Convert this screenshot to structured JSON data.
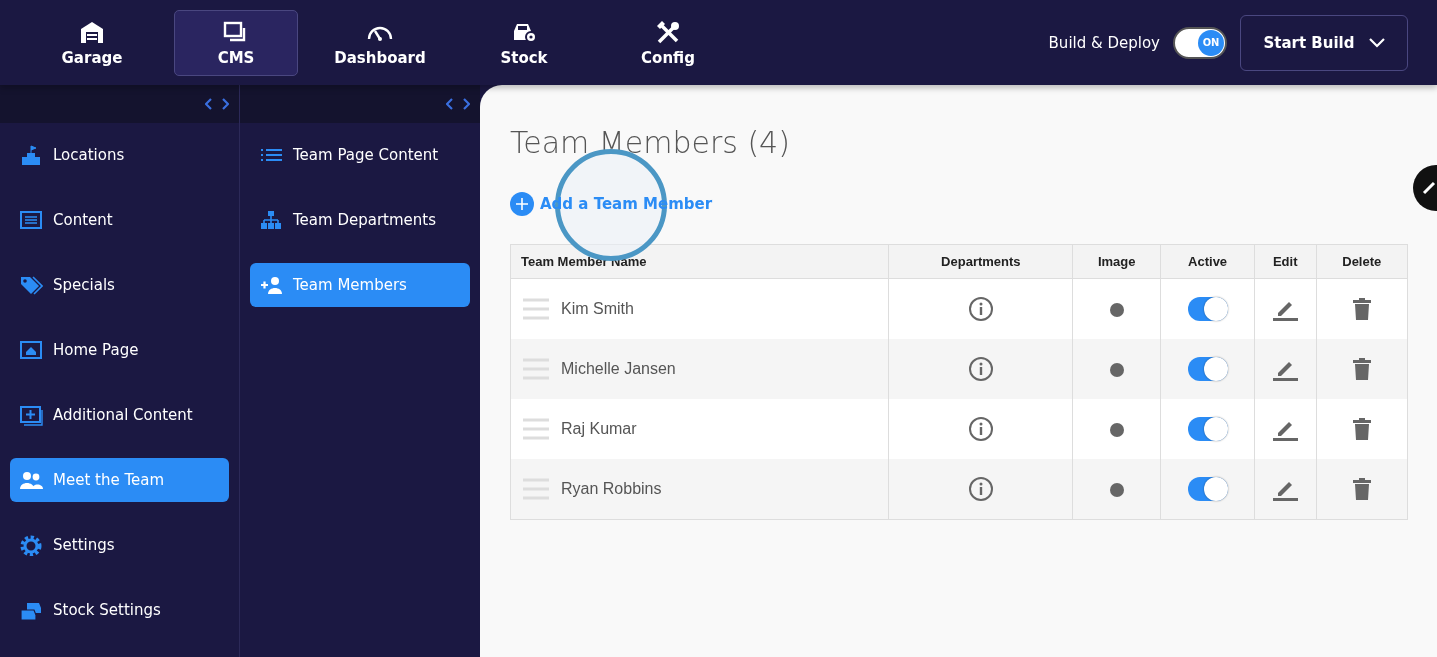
{
  "top_nav": [
    {
      "label": "Garage",
      "kind": "garage",
      "selected": false
    },
    {
      "label": "CMS",
      "kind": "cms",
      "selected": true
    },
    {
      "label": "Dashboard",
      "kind": "gauge",
      "selected": false
    },
    {
      "label": "Stock",
      "kind": "car",
      "selected": false
    },
    {
      "label": "Config",
      "kind": "tools",
      "selected": false
    }
  ],
  "build_deploy": {
    "label": "Build & Deploy",
    "toggle_text": "ON",
    "on": true
  },
  "start_build": {
    "label": "Start Build"
  },
  "sidebar": {
    "items": [
      {
        "label": "Locations",
        "kind": "location",
        "selected": false
      },
      {
        "label": "Content",
        "kind": "content",
        "selected": false
      },
      {
        "label": "Specials",
        "kind": "tag",
        "selected": false
      },
      {
        "label": "Home Page",
        "kind": "home",
        "selected": false
      },
      {
        "label": "Additional Content",
        "kind": "add",
        "selected": false
      },
      {
        "label": "Meet the Team",
        "kind": "team",
        "selected": true
      },
      {
        "label": "Settings",
        "kind": "gear",
        "selected": false
      },
      {
        "label": "Stock Settings",
        "kind": "cars",
        "selected": false
      }
    ]
  },
  "subnav": {
    "items": [
      {
        "label": "Team Page Content",
        "kind": "list",
        "selected": false
      },
      {
        "label": "Team Departments",
        "kind": "hierarchy",
        "selected": false
      },
      {
        "label": "Team Members",
        "kind": "adduser",
        "selected": true
      }
    ]
  },
  "main": {
    "title": "Team Members (4)",
    "add_link": "Add a Team Member",
    "table": {
      "columns": [
        "Team Member Name",
        "Departments",
        "Image",
        "Active",
        "Edit",
        "Delete"
      ],
      "rows": [
        {
          "name": "Kim Smith",
          "active": true
        },
        {
          "name": "Michelle Jansen",
          "active": true
        },
        {
          "name": "Raj Kumar",
          "active": true
        },
        {
          "name": "Ryan Robbins",
          "active": true
        }
      ]
    }
  }
}
